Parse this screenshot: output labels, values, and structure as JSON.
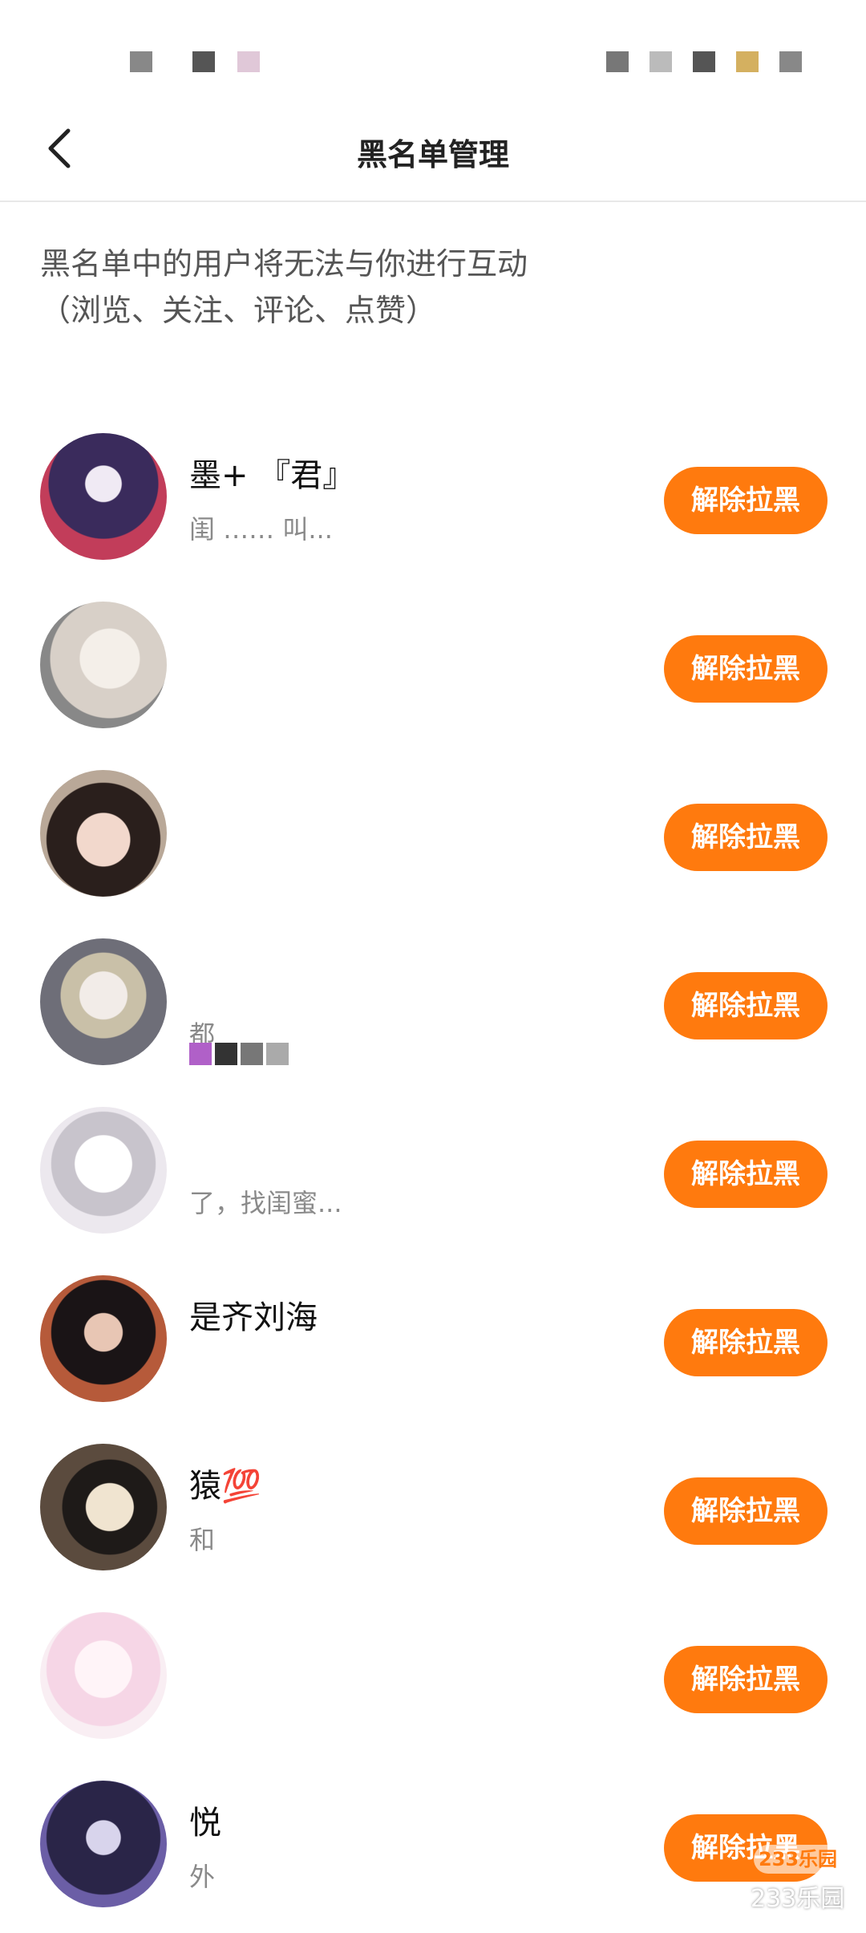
{
  "nav": {
    "title": "黑名单管理"
  },
  "notice": {
    "line1": "黑名单中的用户将无法与你进行互动",
    "line2": "（浏览、关注、评论、点赞）"
  },
  "rows": [
    {
      "name": "墨+ 『君』",
      "bio": "闺 …… 叫...",
      "button": "解除拉黑"
    },
    {
      "name": "",
      "bio": "",
      "button": "解除拉黑"
    },
    {
      "name": "",
      "bio": "",
      "button": "解除拉黑"
    },
    {
      "name": "",
      "bio": "都",
      "button": "解除拉黑"
    },
    {
      "name": "",
      "bio": "了，找闺蜜...",
      "button": "解除拉黑"
    },
    {
      "name": "是齐刘海",
      "bio": "",
      "button": "解除拉黑"
    },
    {
      "name": "猿💯",
      "bio": "和",
      "button": "解除拉黑"
    },
    {
      "name": "",
      "bio": "",
      "button": "解除拉黑"
    },
    {
      "name": "悦",
      "bio": "外",
      "button": "解除拉黑"
    }
  ],
  "watermark": {
    "badge": "233乐园",
    "text": "233乐园"
  },
  "colors": {
    "accent": "#ff7a0e",
    "avatar_bg": [
      "#3a2b5c",
      "#d8d0c8",
      "#b9a898",
      "#6e6e78",
      "#ece8ee",
      "#3b2e36",
      "#5b4b3e",
      "#f6d6e6",
      "#2a2548"
    ]
  }
}
